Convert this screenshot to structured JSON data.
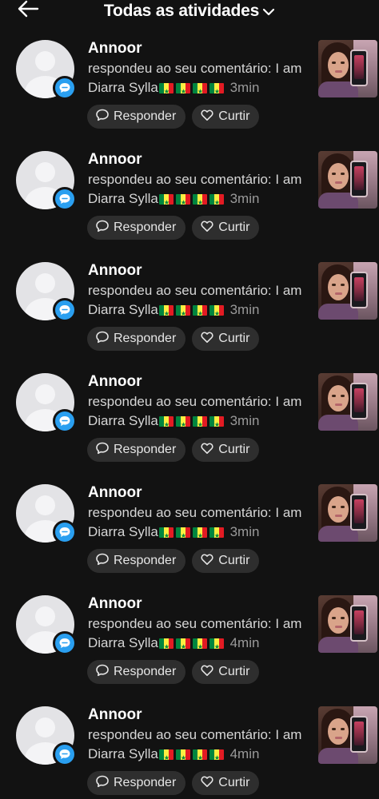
{
  "header": {
    "title": "Todas as atividades"
  },
  "icons": {
    "back": "arrow-left-icon",
    "dropdown": "chevron-down-icon",
    "badge": "comment-bubble-icon",
    "reply": "speech-bubble-icon",
    "like": "heart-icon"
  },
  "colors": {
    "background": "#121212",
    "badge": "#2a9ff0",
    "pill": "#2e2e2e"
  },
  "activities": [
    {
      "username": "Annoor",
      "text": "respondeu ao seu comentário: I am Diarra Sylla",
      "flags": "🇸🇳🇸🇳🇸🇳🇸🇳",
      "time": "3min",
      "reply_label": "Responder",
      "like_label": "Curtir"
    },
    {
      "username": "Annoor",
      "text": "respondeu ao seu comentário: I am Diarra Sylla",
      "flags": "🇸🇳🇸🇳🇸🇳🇸🇳",
      "time": "3min",
      "reply_label": "Responder",
      "like_label": "Curtir"
    },
    {
      "username": "Annoor",
      "text": "respondeu ao seu comentário: I am Diarra Sylla",
      "flags": "🇸🇳🇸🇳🇸🇳🇸🇳",
      "time": "3min",
      "reply_label": "Responder",
      "like_label": "Curtir"
    },
    {
      "username": "Annoor",
      "text": "respondeu ao seu comentário: I am Diarra Sylla",
      "flags": "🇸🇳🇸🇳🇸🇳🇸🇳",
      "time": "3min",
      "reply_label": "Responder",
      "like_label": "Curtir"
    },
    {
      "username": "Annoor",
      "text": "respondeu ao seu comentário: I am Diarra Sylla",
      "flags": "🇸🇳🇸🇳🇸🇳🇸🇳",
      "time": "3min",
      "reply_label": "Responder",
      "like_label": "Curtir"
    },
    {
      "username": "Annoor",
      "text": "respondeu ao seu comentário: I am Diarra Sylla",
      "flags": "🇸🇳🇸🇳🇸🇳🇸🇳",
      "time": "4min",
      "reply_label": "Responder",
      "like_label": "Curtir"
    },
    {
      "username": "Annoor",
      "text": "respondeu ao seu comentário: I am Diarra Sylla",
      "flags": "🇸🇳🇸🇳🇸🇳🇸🇳",
      "time": "4min",
      "reply_label": "Responder",
      "like_label": "Curtir"
    }
  ]
}
